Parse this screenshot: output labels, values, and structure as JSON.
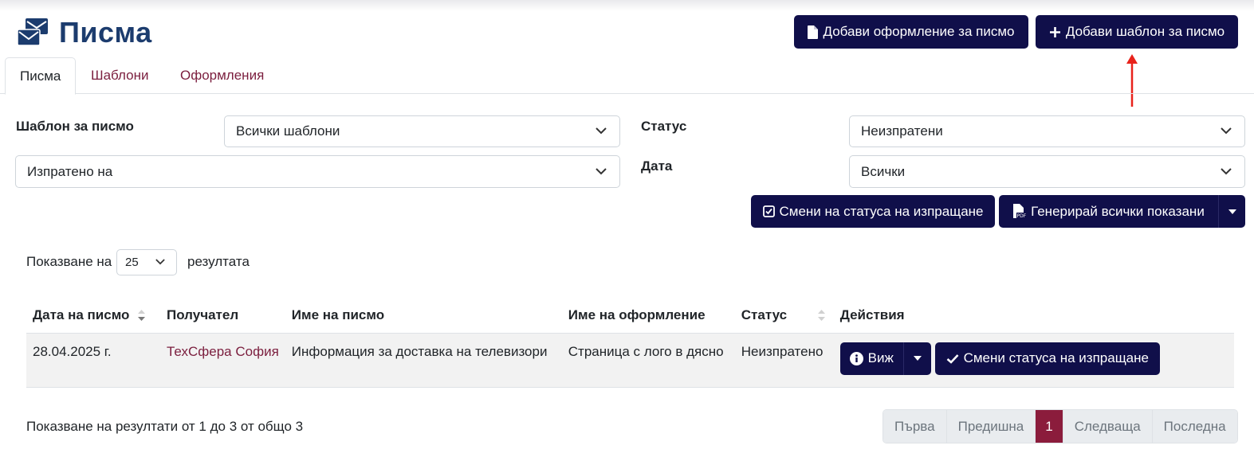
{
  "header": {
    "title": "Писма"
  },
  "toolbar": {
    "add_design_label": "Добави оформление за писмо",
    "add_template_label": "Добави шаблон за писмо"
  },
  "tabs": [
    {
      "label": "Писма",
      "active": true
    },
    {
      "label": "Шаблони",
      "active": false
    },
    {
      "label": "Оформления",
      "active": false
    }
  ],
  "filters": {
    "template_label": "Шаблон за писмо",
    "template_value": "Всички шаблони",
    "sent_on_value": "Изпратено на",
    "status_label": "Статус",
    "status_value": "Неизпратени",
    "date_label": "Дата",
    "date_value": "Всички"
  },
  "actions": {
    "change_status_label": "Смени на статуса на изпращане",
    "generate_all_label": "Генерирай всички показани"
  },
  "page_size": {
    "prefix": "Показване на",
    "value": "25",
    "suffix": "резултата"
  },
  "table": {
    "headers": [
      "Дата на писмо",
      "Получател",
      "Име на писмо",
      "Име на оформление",
      "Статус",
      "Действия"
    ],
    "rows": [
      {
        "date": "28.04.2025 г.",
        "recipient": "ТехСфера София",
        "letter_name": "Информация за доставка на телевизори",
        "design_name": "Страница с лого в дясно",
        "status": "Неизпратено",
        "view_label": "Виж",
        "change_status_label": "Смени статуса на изпращане"
      }
    ]
  },
  "footer": {
    "summary": "Показване на резултати от 1 до 3 от общо 3"
  },
  "pagination": {
    "first": "Първа",
    "prev": "Предишна",
    "current": "1",
    "next": "Следваща",
    "last": "Последна"
  },
  "colors": {
    "primary": "#100f4a",
    "accent": "#7b1e3e",
    "title": "#1c3c6e",
    "annotation": "#e8221b"
  }
}
